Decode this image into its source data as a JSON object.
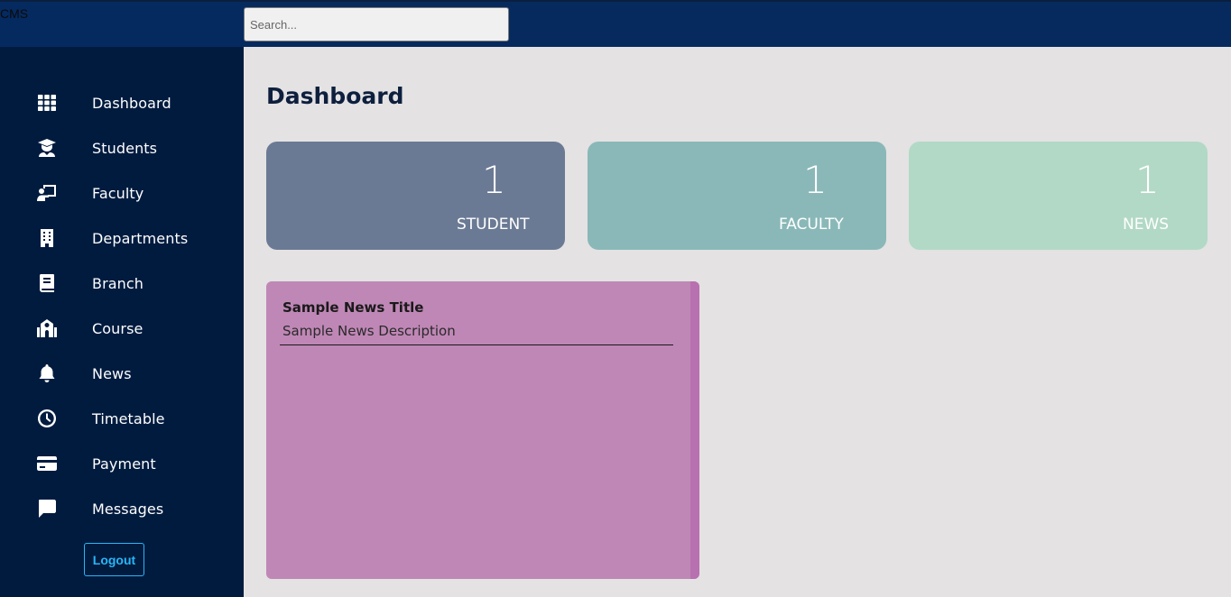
{
  "app": {
    "brand": "CMS"
  },
  "search": {
    "placeholder": "Search..."
  },
  "sidebar": {
    "items": [
      {
        "label": "Dashboard",
        "icon": "grid-icon"
      },
      {
        "label": "Students",
        "icon": "graduate-icon"
      },
      {
        "label": "Faculty",
        "icon": "teacher-icon"
      },
      {
        "label": "Departments",
        "icon": "building-icon"
      },
      {
        "label": "Branch",
        "icon": "book-icon"
      },
      {
        "label": "Course",
        "icon": "school-icon"
      },
      {
        "label": "News",
        "icon": "bell-icon"
      },
      {
        "label": "Timetable",
        "icon": "clock-icon"
      },
      {
        "label": "Payment",
        "icon": "credit-card-icon"
      },
      {
        "label": "Messages",
        "icon": "message-icon"
      }
    ],
    "logout_label": "Logout"
  },
  "main": {
    "title": "Dashboard",
    "stats": [
      {
        "value": "1",
        "label": "STUDENT",
        "color": "#6b7a94"
      },
      {
        "value": "1",
        "label": "FACULTY",
        "color": "#8ab8b8"
      },
      {
        "value": "1",
        "label": "NEWS",
        "color": "#b2d9c6"
      }
    ],
    "news": {
      "title": "Sample News Title",
      "description": "Sample News Description",
      "color": "#bf87b6"
    }
  }
}
